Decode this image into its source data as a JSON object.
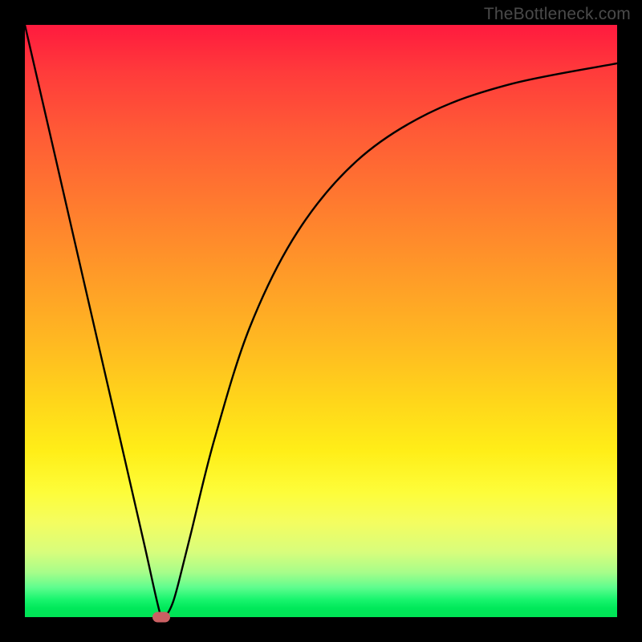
{
  "watermark": "TheBottleneck.com",
  "colors": {
    "frame": "#000000",
    "curve": "#000000",
    "marker": "#cb6063"
  },
  "chart_data": {
    "type": "line",
    "title": "",
    "xlabel": "",
    "ylabel": "",
    "xlim": [
      0,
      100
    ],
    "ylim": [
      0,
      100
    ],
    "series": [
      {
        "name": "bottleneck-curve",
        "x": [
          0,
          5,
          10,
          15,
          20,
          23,
          24,
          25,
          26,
          28,
          32,
          38,
          46,
          56,
          68,
          82,
          100
        ],
        "values": [
          100,
          78.3,
          56.5,
          34.8,
          13.0,
          0.0,
          0.5,
          2.5,
          6.0,
          14.0,
          30.0,
          49.0,
          65.0,
          77.0,
          85.0,
          90.0,
          93.5
        ]
      }
    ],
    "bottleneck_point": {
      "x": 23,
      "y": 0
    },
    "gradient_stops": [
      {
        "pct": 0,
        "color": "#ff1a3e"
      },
      {
        "pct": 50,
        "color": "#ffba21"
      },
      {
        "pct": 80,
        "color": "#fdfd3a"
      },
      {
        "pct": 100,
        "color": "#00e455"
      }
    ]
  }
}
